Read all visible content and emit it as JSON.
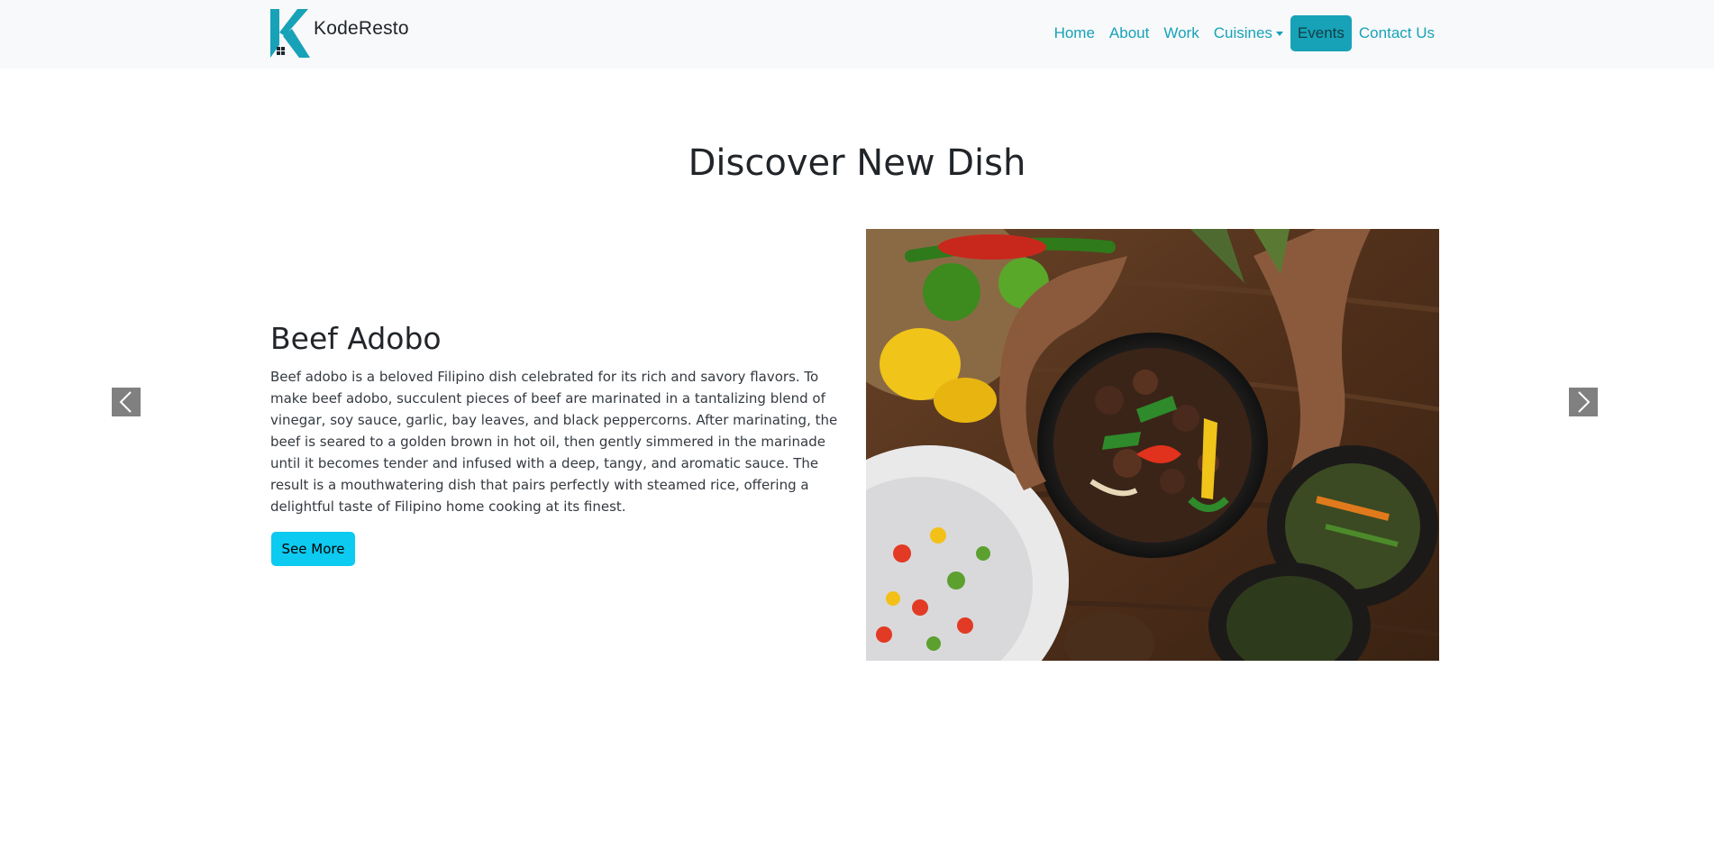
{
  "brand": {
    "name": "KodeResto",
    "logo_icon": "k-logo-icon",
    "accent": "#17a2b8"
  },
  "nav": {
    "items": [
      {
        "label": "Home"
      },
      {
        "label": "About"
      },
      {
        "label": "Work"
      },
      {
        "label": "Cuisines"
      },
      {
        "label": "Events"
      },
      {
        "label": "Contact Us"
      }
    ],
    "active_item": "Events"
  },
  "section": {
    "title": "Discover New Dish"
  },
  "slide": {
    "title": "Beef Adobo",
    "description": "Beef adobo is a beloved Filipino dish celebrated for its rich and savory flavors. To make beef adobo, succulent pieces of beef are marinated in a tantalizing blend of vinegar, soy sauce, garlic, bay leaves, and black peppercorns. After marinating, the beef is seared to a golden brown in hot oil, then gently simmered in the marinade until it becomes tender and infused with a deep, tangy, and aromatic sauce. The result is a mouthwatering dish that pairs perfectly with steamed rice, offering a delightful taste of Filipino home cooking at its finest.",
    "button_label": "See More",
    "button_color": "#0dcaf0",
    "image_icon": "dish-photo"
  },
  "carousel": {
    "prev_icon": "chevron-left-icon",
    "next_icon": "chevron-right-icon"
  }
}
